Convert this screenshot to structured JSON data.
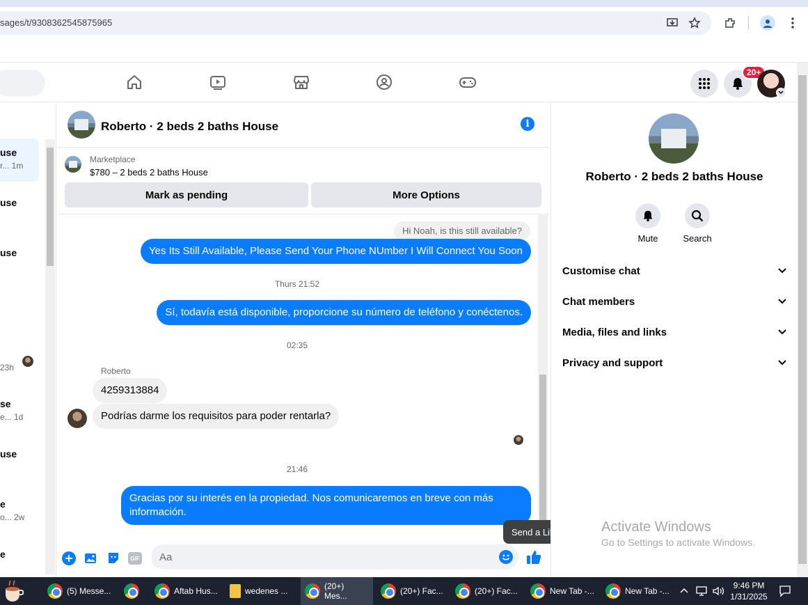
{
  "browser": {
    "url": "sages/t/9308362545875965"
  },
  "nav": {
    "notif_badge": "20+"
  },
  "sidebar": {
    "items": [
      {
        "title": "use",
        "time": "r... 1m"
      },
      {
        "title": "use",
        "time": ""
      },
      {
        "title": "use",
        "time": ""
      },
      {
        "title": "",
        "time": "23h"
      },
      {
        "title": "se",
        "time": "e... 1d"
      },
      {
        "title": "use",
        "time": ""
      },
      {
        "title": "e",
        "time": "o... 2w"
      },
      {
        "title": "e",
        "time": ""
      }
    ]
  },
  "conversation": {
    "title": "Roberto · 2 beds 2 baths House",
    "marketplace_label": "Marketplace",
    "listing": "$780 – 2 beds 2 baths House",
    "mark_pending": "Mark as pending",
    "more_options": "More Options"
  },
  "messages": {
    "m1": "Hi Noah, is this still available?",
    "m2": "Yes Its Still Available, Please Send Your Phone NUmber I Will Connect You Soon",
    "stamp1": "Thurs 21:52",
    "m3": "Sí, todavía está disponible, proporcione su número de teléfono y conéctenos.",
    "stamp2": "02:35",
    "sender": "Roberto",
    "m4": "4259313884",
    "m5": "Podrías darme los requisitos para poder rentarla?",
    "stamp3": "21:46",
    "m6": "Gracias por su interés en la propiedad. Nos comunicaremos en breve con más información."
  },
  "composer": {
    "placeholder": "Aa",
    "tooltip": "Send a Like",
    "gif": "GIF"
  },
  "right_panel": {
    "name": "Roberto · 2 beds 2 baths House",
    "mute": "Mute",
    "search": "Search",
    "sections": [
      "Customise chat",
      "Chat members",
      "Media, files and links",
      "Privacy and support"
    ]
  },
  "watermark": {
    "line1": "Activate Windows",
    "line2": "Go to Settings to activate Windows."
  },
  "taskbar": {
    "tasks": [
      "(5) Messe...",
      "",
      "Aftab Hus...",
      "wedenes ...",
      "(20+) Mes...",
      "(20+) Fac...",
      "(20+) Fac...",
      "New Tab -...",
      "New Tab -..."
    ],
    "time": "9:46 PM",
    "date": "1/31/2025"
  },
  "colors": {
    "messenger_blue": "#0a7cff",
    "badge_red": "#e41e3f",
    "taskbar": "#1c2230"
  }
}
